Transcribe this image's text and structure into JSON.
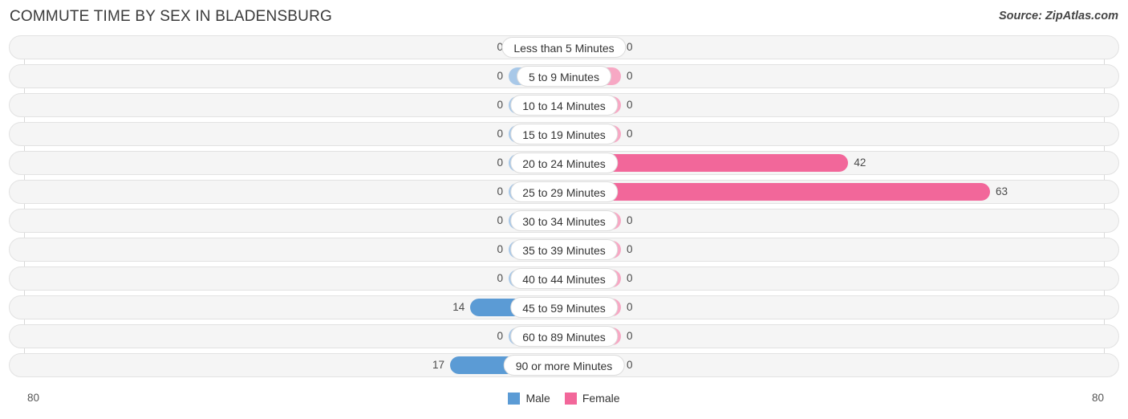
{
  "header": {
    "title": "COMMUTE TIME BY SEX IN BLADENSBURG",
    "source": "Source: ZipAtlas.com"
  },
  "legend": {
    "male_label": "Male",
    "female_label": "Female",
    "male_color": "#5b9bd5",
    "female_color": "#f2679a"
  },
  "axis": {
    "left_tick": "80",
    "right_tick": "80"
  },
  "colors": {
    "male_strong": "#5b9bd5",
    "male_faint": "#a8c8e8",
    "female_strong": "#f2679a",
    "female_faint": "#f7a8c4",
    "row_track": "#f5f5f5",
    "row_border": "#e2e2e2"
  },
  "chart_data": {
    "type": "bar",
    "subtype": "diverging-bidirectional",
    "title": "COMMUTE TIME BY SEX IN BLADENSBURG",
    "xlabel": "",
    "ylabel": "",
    "xlim": [
      80,
      80
    ],
    "grid": false,
    "legend_position": "bottom-center",
    "categories": [
      "Less than 5 Minutes",
      "5 to 9 Minutes",
      "10 to 14 Minutes",
      "15 to 19 Minutes",
      "20 to 24 Minutes",
      "25 to 29 Minutes",
      "30 to 34 Minutes",
      "35 to 39 Minutes",
      "40 to 44 Minutes",
      "45 to 59 Minutes",
      "60 to 89 Minutes",
      "90 or more Minutes"
    ],
    "series": [
      {
        "name": "Male",
        "direction": "left",
        "values": [
          0,
          0,
          0,
          0,
          0,
          0,
          0,
          0,
          0,
          14,
          0,
          17
        ]
      },
      {
        "name": "Female",
        "direction": "right",
        "values": [
          0,
          0,
          0,
          0,
          42,
          63,
          0,
          0,
          0,
          0,
          0,
          0
        ]
      }
    ]
  },
  "rows": [
    {
      "label": "Less than 5 Minutes",
      "male": "0",
      "female": "0"
    },
    {
      "label": "5 to 9 Minutes",
      "male": "0",
      "female": "0"
    },
    {
      "label": "10 to 14 Minutes",
      "male": "0",
      "female": "0"
    },
    {
      "label": "15 to 19 Minutes",
      "male": "0",
      "female": "0"
    },
    {
      "label": "20 to 24 Minutes",
      "male": "0",
      "female": "42"
    },
    {
      "label": "25 to 29 Minutes",
      "male": "0",
      "female": "63"
    },
    {
      "label": "30 to 34 Minutes",
      "male": "0",
      "female": "0"
    },
    {
      "label": "35 to 39 Minutes",
      "male": "0",
      "female": "0"
    },
    {
      "label": "40 to 44 Minutes",
      "male": "0",
      "female": "0"
    },
    {
      "label": "45 to 59 Minutes",
      "male": "14",
      "female": "0"
    },
    {
      "label": "60 to 89 Minutes",
      "male": "0",
      "female": "0"
    },
    {
      "label": "90 or more Minutes",
      "male": "17",
      "female": "0"
    }
  ]
}
